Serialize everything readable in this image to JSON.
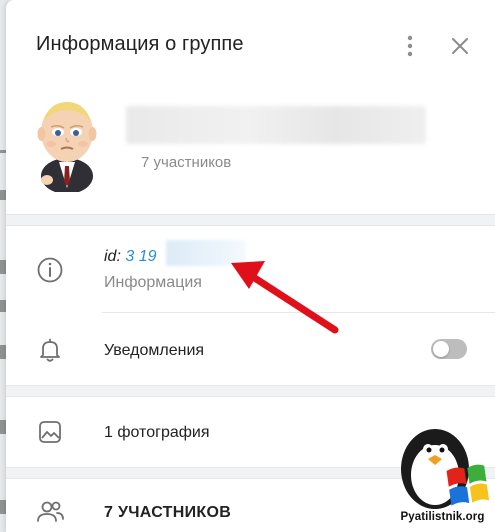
{
  "dialog": {
    "title": "Информация о группе"
  },
  "header": {
    "more_icon": "more-vertical-icon",
    "close_icon": "close-icon"
  },
  "profile": {
    "members_count": "7 участников"
  },
  "info": {
    "id_prefix": "id:",
    "id_value": "3 19",
    "label": "Информация"
  },
  "notifications": {
    "label": "Уведомления",
    "enabled": false
  },
  "photos": {
    "label": "1 фотография"
  },
  "members": {
    "label": "7 УЧАСТНИКОВ"
  },
  "watermark": {
    "text": "Pyatilistnik.org"
  },
  "colors": {
    "accent": "#2b8fd6",
    "arrow": "#e0101a",
    "toggle_off": "#bdbdbd"
  }
}
